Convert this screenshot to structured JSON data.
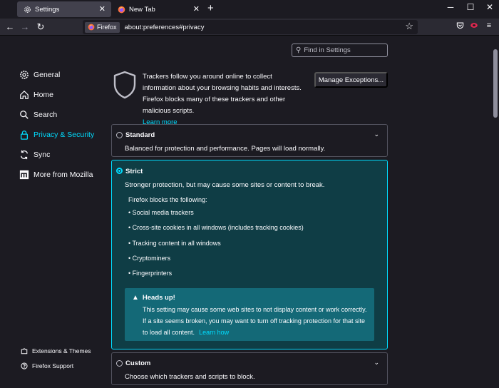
{
  "tabs": [
    {
      "title": "Settings",
      "active": true
    },
    {
      "title": "New Tab",
      "active": false
    }
  ],
  "toolbar": {
    "identity_label": "Firefox",
    "url": "about:preferences#privacy"
  },
  "search": {
    "placeholder": "Find in Settings"
  },
  "sidebar": {
    "items": [
      {
        "label": "General",
        "icon": "gear-icon"
      },
      {
        "label": "Home",
        "icon": "home-icon"
      },
      {
        "label": "Search",
        "icon": "search-icon"
      },
      {
        "label": "Privacy & Security",
        "icon": "lock-icon",
        "active": true
      },
      {
        "label": "Sync",
        "icon": "sync-icon"
      },
      {
        "label": "More from Mozilla",
        "icon": "mozilla-icon"
      }
    ],
    "footer": [
      {
        "label": "Extensions & Themes",
        "icon": "puzzle-icon"
      },
      {
        "label": "Firefox Support",
        "icon": "help-icon"
      }
    ]
  },
  "intro": {
    "text": "Trackers follow you around online to collect information about your browsing habits and interests. Firefox blocks many of these trackers and other malicious scripts.",
    "learn_more": "Learn more",
    "manage_button": "Manage Exceptions..."
  },
  "options": {
    "standard": {
      "title": "Standard",
      "desc": "Balanced for protection and performance. Pages will load normally."
    },
    "strict": {
      "title": "Strict",
      "desc": "Stronger protection, but may cause some sites or content to break.",
      "blocks_heading": "Firefox blocks the following:",
      "blocks": [
        "Social media trackers",
        "Cross-site cookies in all windows (includes tracking cookies)",
        "Tracking content in all windows",
        "Cryptominers",
        "Fingerprinters"
      ],
      "headsup_title": "Heads up!",
      "headsup_text": "This setting may cause some web sites to not display content or work correctly. If a site seems broken, you may want to turn off tracking protection for that site to load all content.",
      "headsup_link": "Learn how"
    },
    "custom": {
      "title": "Custom",
      "desc": "Choose which trackers and scripts to block."
    }
  },
  "colors": {
    "accent": "#00ddff",
    "background": "#1c1b22",
    "selected_card": "#0f3d45",
    "headsup": "#146977"
  }
}
